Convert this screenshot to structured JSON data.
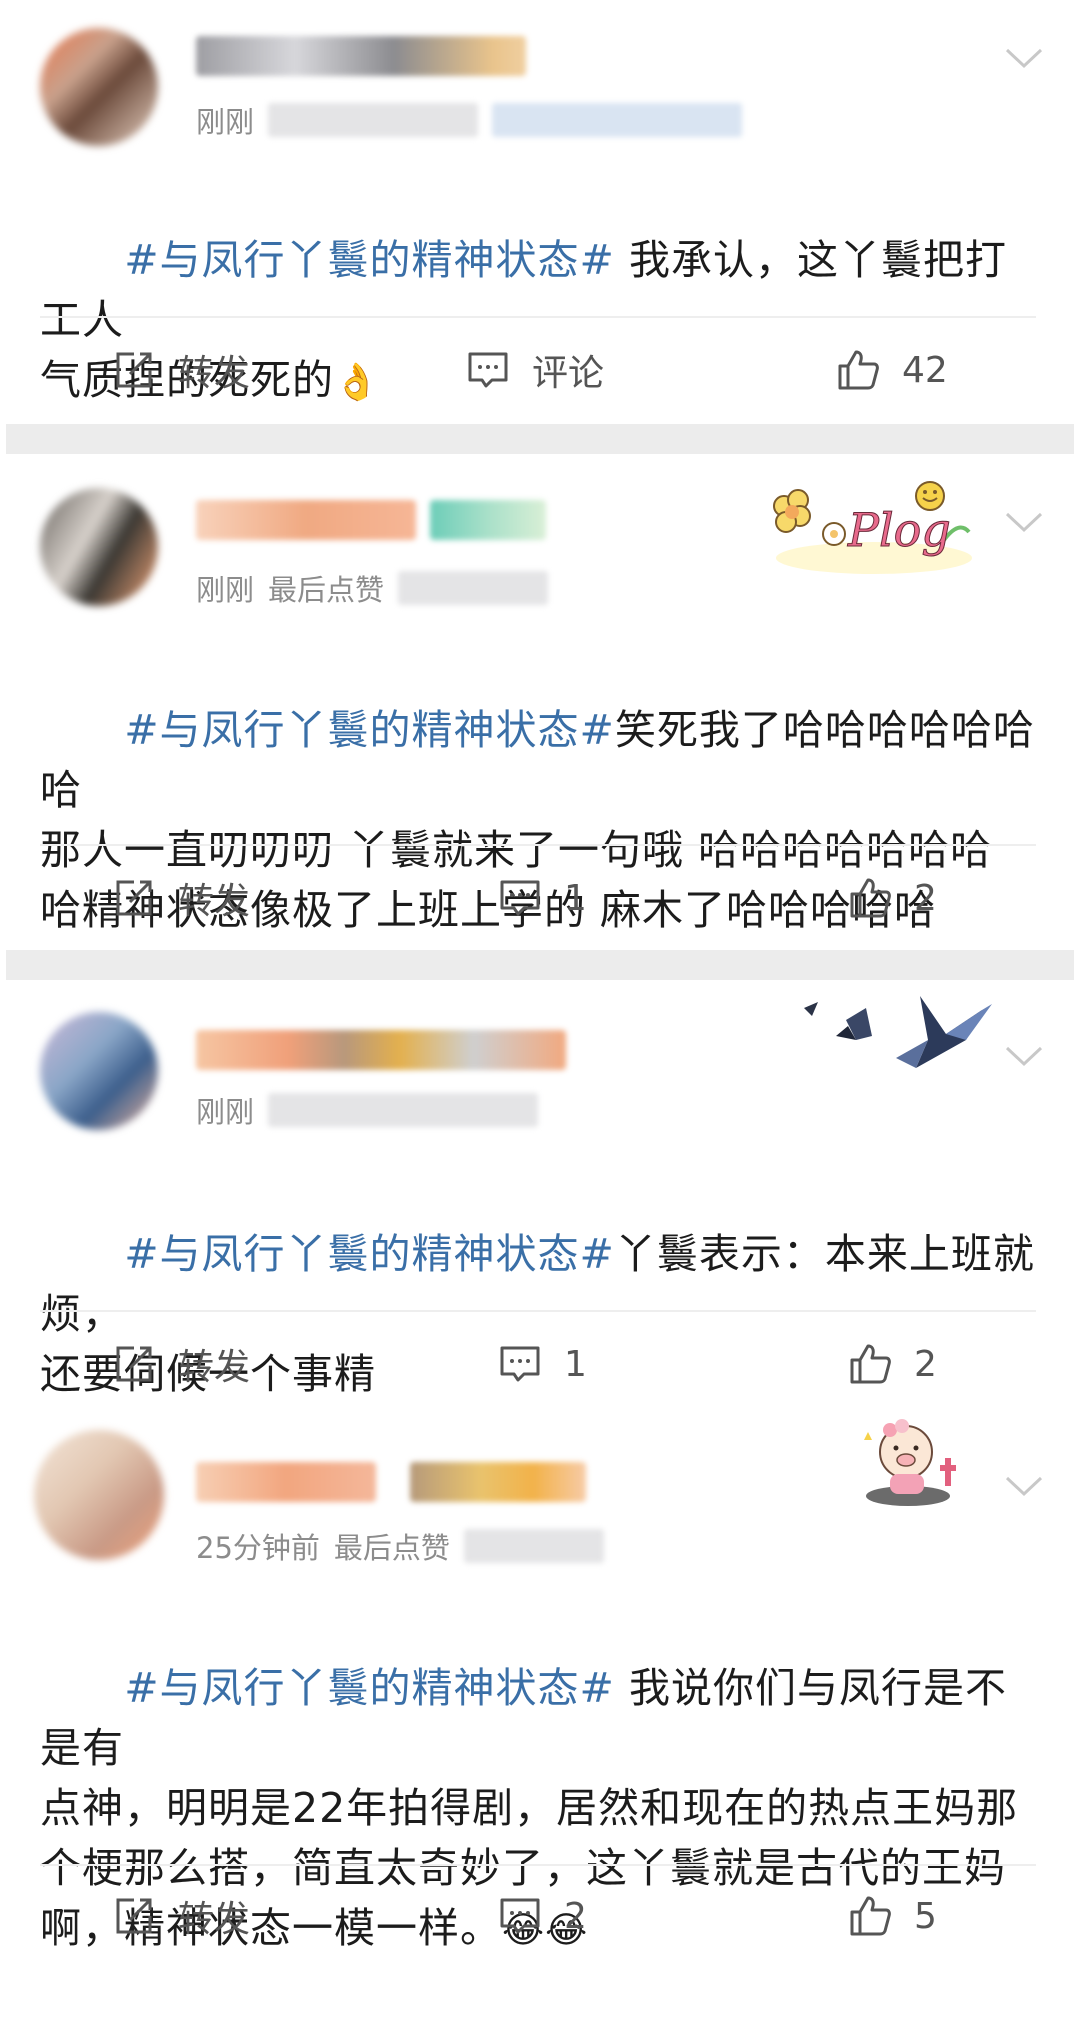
{
  "posts": [
    {
      "meta_time": "刚刚",
      "meta_extra": "",
      "topic": "#与凤行丫鬟的精神状态#",
      "body": " 我承认，这丫鬟把打工人\n气质捏的死死的",
      "emoji": "👌",
      "actions": {
        "repost_label": "转发",
        "comment_label": "评论",
        "like_count": "42"
      }
    },
    {
      "meta_time": "刚刚",
      "meta_extra": "最后点赞",
      "sticker_text": "Plog",
      "topic": "#与凤行丫鬟的精神状态#",
      "body": "笑死我了哈哈哈哈哈哈哈\n那人一直叨叨叨 丫鬟就来了一句哦 哈哈哈哈哈哈哈\n哈精神状态像极了上班上学的 麻木了哈哈哈哈哈",
      "actions": {
        "repost_label": "转发",
        "comment_count": "1",
        "like_count": "2"
      }
    },
    {
      "meta_time": "刚刚",
      "meta_extra": "",
      "topic": "#与凤行丫鬟的精神状态#",
      "body": "丫鬟表示：本来上班就烦，\n还要伺候一个事精",
      "actions": {
        "repost_label": "转发",
        "comment_count": "1",
        "like_count": "2"
      }
    },
    {
      "meta_time": "25分钟前",
      "meta_extra": "最后点赞",
      "topic": "#与凤行丫鬟的精神状态#",
      "body": " 我说你们与凤行是不是有\n点神，明明是22年拍得剧，居然和现在的热点王妈那\n个梗那么搭，简直太奇妙了，这丫鬟就是古代的王妈\n啊，精神状态一模一样。",
      "emoji": "😂😂",
      "actions": {
        "repost_label": "转发",
        "comment_count": "2",
        "like_count": "5"
      }
    }
  ],
  "colors": {
    "topic": "#3a6fa7",
    "separator": "#ececec",
    "icon": "#555555"
  }
}
